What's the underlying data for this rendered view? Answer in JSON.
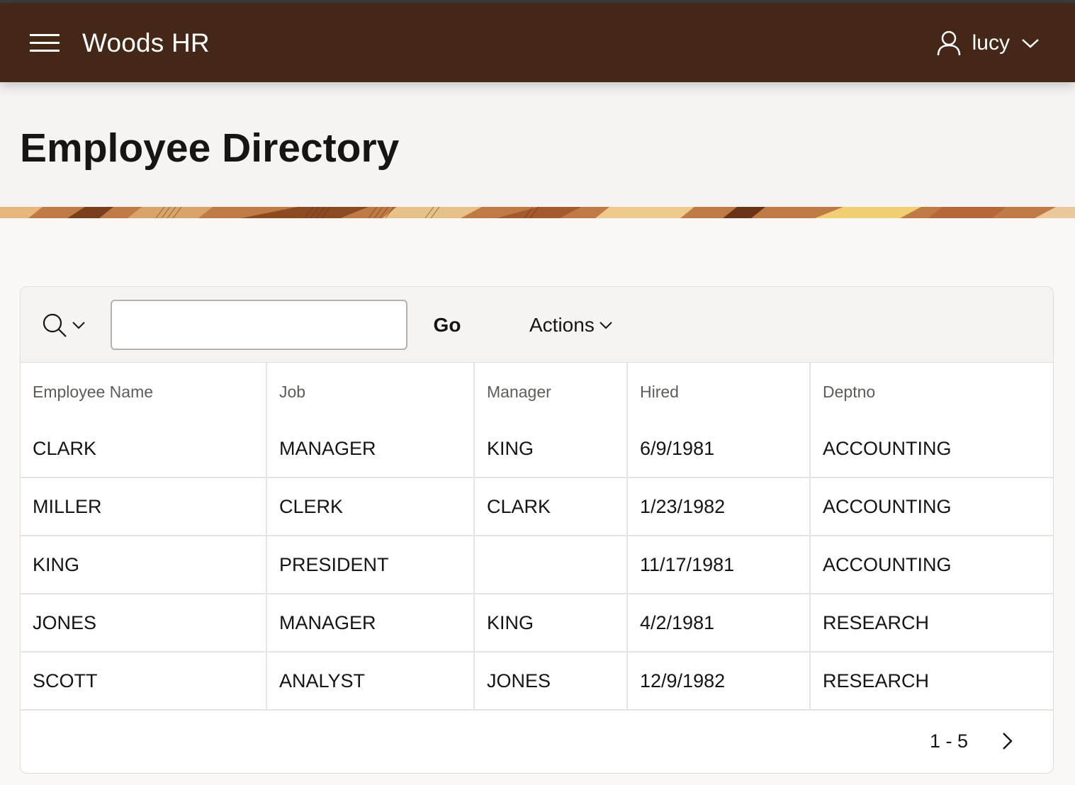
{
  "header": {
    "app_title": "Woods HR",
    "user_name": "lucy",
    "background_color": "#452717",
    "icons": {
      "menu": "hamburger-menu-icon",
      "user": "user-icon",
      "user_menu": "chevron-down-icon"
    }
  },
  "page": {
    "title": "Employee Directory"
  },
  "toolbar": {
    "search_value": "",
    "go_label": "Go",
    "actions_label": "Actions",
    "icons": {
      "search": "search-icon",
      "search_menu": "chevron-down-icon",
      "actions_menu": "chevron-down-icon"
    }
  },
  "table": {
    "columns": [
      "Employee Name",
      "Job",
      "Manager",
      "Hired",
      "Deptno"
    ],
    "rows": [
      [
        "CLARK",
        "MANAGER",
        "KING",
        "6/9/1981",
        "ACCOUNTING"
      ],
      [
        "MILLER",
        "CLERK",
        "CLARK",
        "1/23/1982",
        "ACCOUNTING"
      ],
      [
        "KING",
        "PRESIDENT",
        "",
        "11/17/1981",
        "ACCOUNTING"
      ],
      [
        "JONES",
        "MANAGER",
        "KING",
        "4/2/1981",
        "RESEARCH"
      ],
      [
        "SCOTT",
        "ANALYST",
        "JONES",
        "12/9/1982",
        "RESEARCH"
      ]
    ]
  },
  "pagination": {
    "range": "1 - 5",
    "icons": {
      "next": "chevron-right-icon"
    }
  }
}
